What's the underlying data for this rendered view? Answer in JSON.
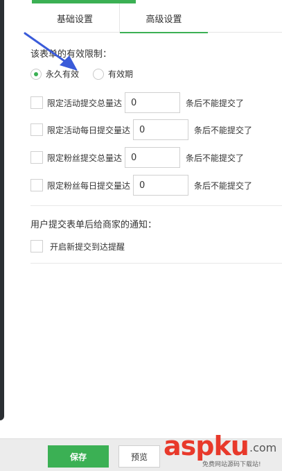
{
  "tabs": [
    {
      "label": "基础设置",
      "active": false
    },
    {
      "label": "高级设置",
      "active": true
    }
  ],
  "validity": {
    "title": "该表单的有效限制：",
    "options": [
      {
        "label": "永久有效",
        "checked": true
      },
      {
        "label": "有效期",
        "checked": false
      }
    ]
  },
  "limits": [
    {
      "label": "限定活动提交总量达",
      "value": "0",
      "suffix": "条后不能提交了"
    },
    {
      "label": "限定活动每日提交量达",
      "value": "0",
      "suffix": "条后不能提交了"
    },
    {
      "label": "限定粉丝提交总量达",
      "value": "0",
      "suffix": "条后不能提交了"
    },
    {
      "label": "限定粉丝每日提交量达",
      "value": "0",
      "suffix": "条后不能提交了"
    }
  ],
  "notify": {
    "title": "用户提交表单后给商家的通知：",
    "option_label": "开启新提交到达提醒"
  },
  "footer": {
    "save_label": "保存",
    "preview_label": "预览"
  },
  "watermark": {
    "brand_a": "asp",
    "brand_b": "ku",
    "domain": ".com",
    "tagline": "免费网站源码下载站!"
  },
  "colors": {
    "accent": "#3bb054",
    "arrow": "#3a5bd9",
    "watermark": "#e8392b"
  }
}
